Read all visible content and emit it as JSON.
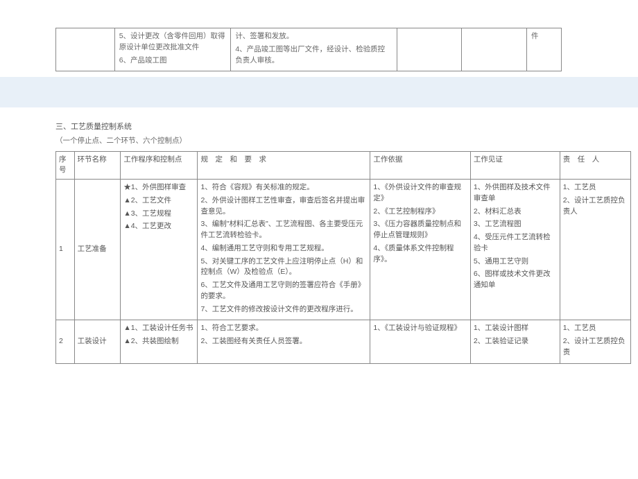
{
  "topTable": {
    "col2": "5、设计更改（含零件回用）取得原设计单位更改批准文件\n6、产品竣工图",
    "col3": "计、签署和发放。\n4、产品竣工图等出厂文件，经设计、检验质控负责人审核。",
    "col6": "件"
  },
  "sectionTitle": "三、工艺质量控制系统",
  "subtitle": "（一个停止点、二个环节、六个控制点）",
  "headers": {
    "xh": "序号",
    "hj": "环节名称",
    "gc": "工作程序和控制点",
    "gd": "规　定　和　要　求",
    "yj": "工作依据",
    "jz": "工作见证",
    "zr": "责　任　人"
  },
  "rows": [
    {
      "xh": "1",
      "hj": "工艺准备",
      "gc": [
        "★1、外供图样审查",
        "▲2、工艺文件",
        "▲3、工艺规程",
        "▲4、工艺更改"
      ],
      "gd": [
        "1、符合《容规》有关标准的规定。",
        "2、外供设计图样工艺性审查，审查后签名并提出审查意见。",
        "3、编制\"材料汇总表\"、工艺流程图、各主要受压元件工艺流转检验卡。",
        "4、编制通用工艺守则和专用工艺规程。",
        "5、对关键工序的工艺文件上应注明停止点（H）和控制点（W）及检验点（E）。",
        "6、工艺文件及通用工艺守则的签署应符合《手册》的要求。",
        "7、工艺文件的修改按设计文件的更改程序进行。"
      ],
      "yj": [
        "1、《外供设计文件的审查规定》",
        "2、《工艺控制程序》",
        "3、《压力容器质量控制点和停止点管理规则》",
        "4、《质量体系文件控制程序》。"
      ],
      "jz": [
        "1、外供图样及技术文件审查单",
        "2、材料汇总表",
        "3、工艺流程图",
        "4、受压元件工艺流转检验卡",
        "5、通用工艺守则",
        "6、图样或技术文件更改通知单"
      ],
      "zr": [
        "1、工艺员",
        "2、设计工艺质控负责人"
      ]
    },
    {
      "xh": "2",
      "hj": "工装设计",
      "gc": [
        "▲1、工装设计任务书",
        "▲2、共装图绘制"
      ],
      "gd": [
        "1、符合工艺要求。",
        "2、工装图经有关责任人员签署。"
      ],
      "yj": [
        "1、《工装设计与验证规程》"
      ],
      "jz": [
        "1、工装设计图样",
        "2、工装验证记录"
      ],
      "zr": [
        "1、工艺员",
        "2、设计工艺质控负责"
      ]
    }
  ]
}
